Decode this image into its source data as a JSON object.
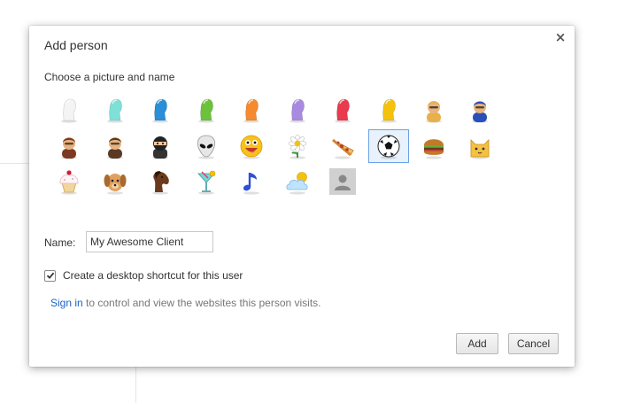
{
  "dialog": {
    "title": "Add person",
    "subtitle": "Choose a picture and name",
    "close_glyph": "×",
    "name_label": "Name:",
    "name_value": "My Awesome Client",
    "shortcut_label": "Create a desktop shortcut for this user",
    "shortcut_checked": true,
    "signin_link": "Sign in",
    "signin_rest": " to control and view the websites this person visits.",
    "add_label": "Add",
    "cancel_label": "Cancel"
  },
  "avatars": [
    {
      "name": "avatar-white-head",
      "kind": "head",
      "color": "#f4f4f4"
    },
    {
      "name": "avatar-teal-head",
      "kind": "head",
      "color": "#7fe0d8"
    },
    {
      "name": "avatar-blue-head",
      "kind": "head",
      "color": "#2a8ed8"
    },
    {
      "name": "avatar-green-head",
      "kind": "head",
      "color": "#6cc23c"
    },
    {
      "name": "avatar-orange-head",
      "kind": "head",
      "color": "#f58a2e"
    },
    {
      "name": "avatar-purple-head",
      "kind": "head",
      "color": "#a88be0"
    },
    {
      "name": "avatar-red-head",
      "kind": "head",
      "color": "#ea3a4e"
    },
    {
      "name": "avatar-yellow-head",
      "kind": "head",
      "color": "#f4c20d"
    },
    {
      "name": "avatar-businesswoman",
      "kind": "person",
      "color": "#e8b04a"
    },
    {
      "name": "avatar-superhero",
      "kind": "person",
      "color": "#2b4fb8"
    },
    {
      "name": "avatar-woman-sunglasses",
      "kind": "person",
      "color": "#7a3b22"
    },
    {
      "name": "avatar-man",
      "kind": "person",
      "color": "#5a3a22"
    },
    {
      "name": "avatar-ninja",
      "kind": "ninja",
      "color": "#222222"
    },
    {
      "name": "avatar-alien",
      "kind": "alien",
      "color": "#e6e6e6"
    },
    {
      "name": "avatar-smiley",
      "kind": "smiley",
      "color": "#f7c21b"
    },
    {
      "name": "avatar-flower",
      "kind": "flower",
      "color": "#ffffff"
    },
    {
      "name": "avatar-pizza",
      "kind": "pizza",
      "color": "#f2c26b"
    },
    {
      "name": "avatar-soccer-ball",
      "kind": "ball",
      "color": "#ffffff"
    },
    {
      "name": "avatar-burger",
      "kind": "burger",
      "color": "#c07a2a"
    },
    {
      "name": "avatar-cat",
      "kind": "cat",
      "color": "#f6c040"
    },
    {
      "name": "avatar-cupcake",
      "kind": "cupcake",
      "color": "#f3a6b8"
    },
    {
      "name": "avatar-dog",
      "kind": "dog",
      "color": "#e0a060"
    },
    {
      "name": "avatar-horse",
      "kind": "horse",
      "color": "#6b3a1c"
    },
    {
      "name": "avatar-cocktail",
      "kind": "cocktail",
      "color": "#7fd3d8"
    },
    {
      "name": "avatar-music-note",
      "kind": "note",
      "color": "#2f4fd6"
    },
    {
      "name": "avatar-sun-cloud",
      "kind": "cloud",
      "color": "#bfe3ff"
    },
    {
      "name": "avatar-generic-profile",
      "kind": "generic",
      "color": "#d0d0d0"
    }
  ],
  "selected_avatar": "avatar-soccer-ball",
  "colors": {
    "link": "#1a62c8",
    "selection_border": "#6aa1e6",
    "selection_fill": "#e8f1fc"
  }
}
